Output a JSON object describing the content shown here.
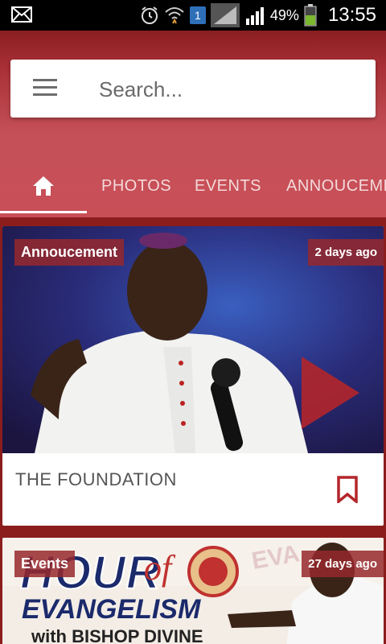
{
  "status_bar": {
    "battery_percent": "49%",
    "time": "13:55",
    "sim_slot": "1",
    "icons": [
      "mail-icon",
      "alarm-icon",
      "wifi-icon",
      "signal-icon",
      "battery-icon"
    ]
  },
  "search": {
    "placeholder": "Search..."
  },
  "tabs": [
    {
      "label": "PHOTOS"
    },
    {
      "label": "EVENTS"
    },
    {
      "label": "ANNOUCEME"
    }
  ],
  "feed": [
    {
      "category": "Annoucement",
      "time": "2 days ago",
      "title": "THE FOUNDATION"
    },
    {
      "category": "Events",
      "time": "27 days ago",
      "poster_text_1": "HOUR",
      "poster_text_2": "of",
      "poster_text_3": "EVANGELISM",
      "poster_text_4": "with BISHOP DIVINE",
      "poster_text_5": "EVA"
    }
  ],
  "colors": {
    "accent": "#8b1d1d",
    "header_light": "#c94f57",
    "badge": "#96282d",
    "play": "#b3262b"
  }
}
